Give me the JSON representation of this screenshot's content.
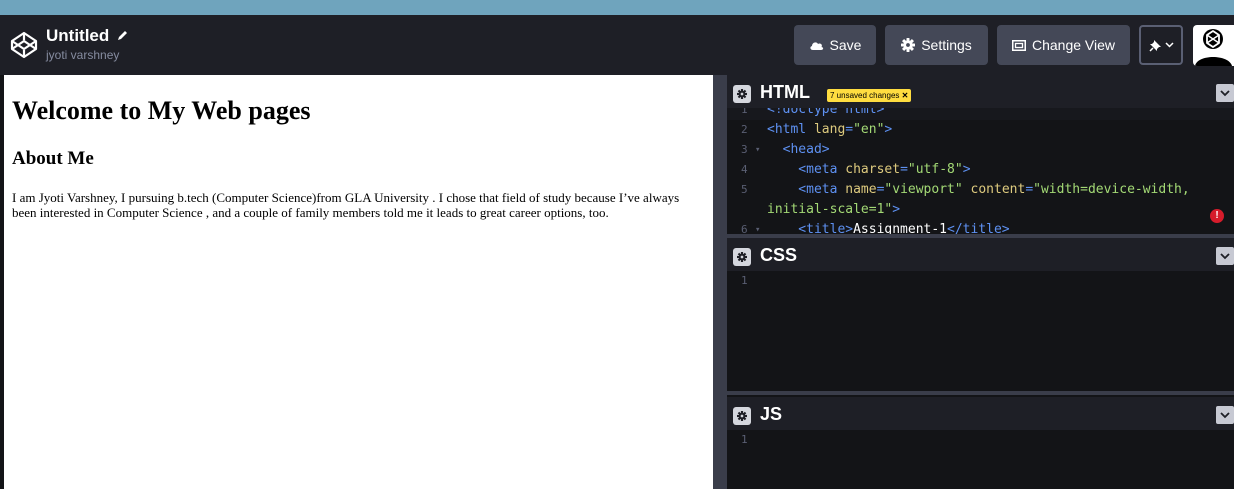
{
  "header": {
    "pen_title": "Untitled",
    "author": "jyoti varshney",
    "buttons": {
      "save": "Save",
      "settings": "Settings",
      "change_view": "Change View"
    },
    "icons": [
      "codepen-logo-icon",
      "pencil-icon",
      "cloud-icon",
      "gear-icon",
      "layout-icon",
      "pin-icon",
      "chevron-down-icon"
    ]
  },
  "preview": {
    "heading": "Welcome to My Web pages",
    "subheading": "About Me",
    "paragraph": "I am Jyoti Varshney, I pursuing b.tech (Computer Science)from GLA University . I chose that field of study because I’ve always been interested in Computer Science , and a couple of family members told me it leads to great career options, too."
  },
  "editors": {
    "html": {
      "title": "HTML",
      "badge": "7 unsaved changes",
      "lines": [
        {
          "num": "1",
          "fold": "",
          "parts": [
            [
              "t-tag",
              "<!doctype html>"
            ]
          ]
        },
        {
          "num": "2",
          "fold": "",
          "parts": [
            [
              "t-tag",
              "<html "
            ],
            [
              "t-att",
              "lang"
            ],
            [
              "t-tag",
              "="
            ],
            [
              "t-str",
              "\"en\""
            ],
            [
              "t-tag",
              ">"
            ]
          ]
        },
        {
          "num": "3",
          "fold": "▾",
          "parts": [
            [
              "t-tag",
              "  <head>"
            ]
          ]
        },
        {
          "num": "4",
          "fold": "",
          "parts": [
            [
              "t-tag",
              "    <meta "
            ],
            [
              "t-att",
              "charset"
            ],
            [
              "t-tag",
              "="
            ],
            [
              "t-str",
              "\"utf-8\""
            ],
            [
              "t-tag",
              ">"
            ]
          ]
        },
        {
          "num": "5",
          "fold": "",
          "parts": [
            [
              "t-tag",
              "    <meta "
            ],
            [
              "t-att",
              "name"
            ],
            [
              "t-tag",
              "="
            ],
            [
              "t-str",
              "\"viewport\""
            ],
            [
              "t-tag",
              " "
            ],
            [
              "t-att",
              "content"
            ],
            [
              "t-tag",
              "="
            ],
            [
              "t-str",
              "\"width=device-width,"
            ]
          ]
        },
        {
          "num": "",
          "fold": "",
          "parts": [
            [
              "t-str",
              "initial-scale=1\""
            ],
            [
              "t-tag",
              ">"
            ]
          ]
        },
        {
          "num": "6",
          "fold": "▾",
          "parts": [
            [
              "t-tag",
              "    <title>"
            ],
            [
              "t-txt",
              "Assignment-1"
            ],
            [
              "t-tag",
              "</title>"
            ]
          ]
        }
      ]
    },
    "css": {
      "title": "CSS",
      "line_number": "1"
    },
    "js": {
      "title": "JS",
      "line_number": "1"
    }
  },
  "colors": {
    "header_bg": "#1e1f26",
    "button_bg": "#444857",
    "badge": "#ffdd40",
    "error": "#d61c2b",
    "tag": "#5e91f2",
    "attribute": "#ddca7e",
    "string": "#a3d975"
  }
}
